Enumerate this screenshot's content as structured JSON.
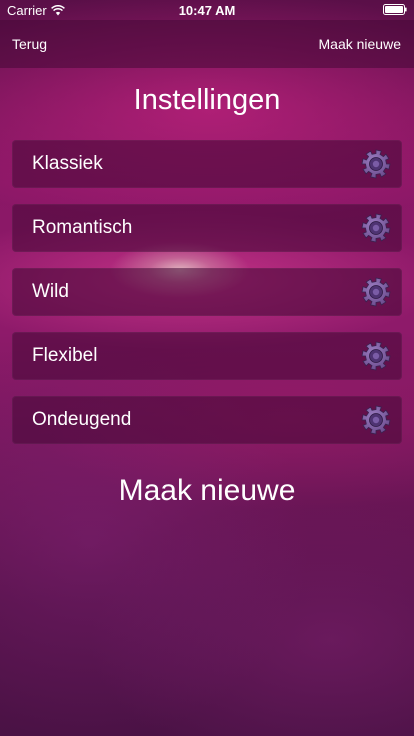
{
  "status_bar": {
    "carrier": "Carrier",
    "time": "10:47 AM"
  },
  "nav": {
    "back_label": "Terug",
    "new_label": "Maak nieuwe"
  },
  "title": "Instellingen",
  "items": [
    {
      "label": "Klassiek",
      "icon": "gear-icon"
    },
    {
      "label": "Romantisch",
      "icon": "gear-icon"
    },
    {
      "label": "Wild",
      "icon": "gear-icon"
    },
    {
      "label": "Flexibel",
      "icon": "gear-icon"
    },
    {
      "label": "Ondeugend",
      "icon": "gear-icon"
    }
  ],
  "create_button": "Maak nieuwe",
  "colors": {
    "background_top": "#5a0f48",
    "background_accent": "#d9248c",
    "row_background": "#46083799",
    "gear_color": "#6a4a8c"
  }
}
